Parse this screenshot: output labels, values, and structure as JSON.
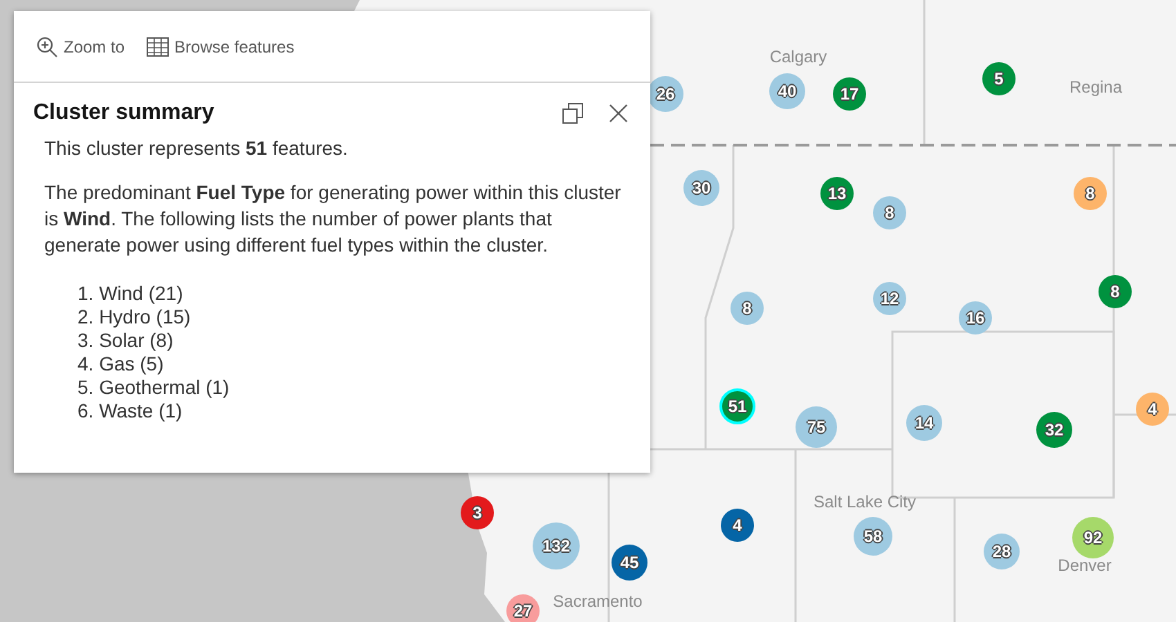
{
  "popup": {
    "actions": [
      {
        "kind": "zoom",
        "label": "Zoom to"
      },
      {
        "kind": "table",
        "label": "Browse features"
      }
    ],
    "title": "Cluster summary",
    "paragraphs": [
      "This cluster represents **51** features.",
      "The predominant **Fuel Type** for generating power within this cluster is **Wind**. The following lists the number of power plants that generate power using different fuel types within the cluster."
    ],
    "list": [
      "1. Wind (21)",
      "2. Hydro (15)",
      "3. Solar (8)",
      "4. Gas (5)",
      "5. Geothermal (1)",
      "6. Waste (1)"
    ]
  },
  "map": {
    "places": [
      "Calgary",
      "Regina",
      "Salt Lake City",
      "Denver",
      "Sacramento"
    ],
    "clusters": [
      {
        "label": "26",
        "color": "#9ecae1",
        "selected": false
      },
      {
        "label": "40",
        "color": "#9ecae1",
        "selected": false
      },
      {
        "label": "17",
        "color": "#00923f",
        "selected": false
      },
      {
        "label": "5",
        "color": "#00923f",
        "selected": false
      },
      {
        "label": "30",
        "color": "#9ecae1",
        "selected": false
      },
      {
        "label": "13",
        "color": "#00923f",
        "selected": false
      },
      {
        "label": "8",
        "color": "#9ecae1",
        "selected": false
      },
      {
        "label": "8",
        "color": "#fdb46a",
        "selected": false
      },
      {
        "label": "8",
        "color": "#9ecae1",
        "selected": false
      },
      {
        "label": "12",
        "color": "#9ecae1",
        "selected": false
      },
      {
        "label": "16",
        "color": "#9ecae1",
        "selected": false
      },
      {
        "label": "8",
        "color": "#00923f",
        "selected": false
      },
      {
        "label": "51",
        "color": "#00923f",
        "selected": true
      },
      {
        "label": "75",
        "color": "#9ecae1",
        "selected": false
      },
      {
        "label": "14",
        "color": "#9ecae1",
        "selected": false
      },
      {
        "label": "32",
        "color": "#00923f",
        "selected": false
      },
      {
        "label": "4",
        "color": "#fdb46a",
        "selected": false
      },
      {
        "label": "3",
        "color": "#e31a1c",
        "selected": false
      },
      {
        "label": "132",
        "color": "#9ecae1",
        "selected": false
      },
      {
        "label": "45",
        "color": "#0565a6",
        "selected": false
      },
      {
        "label": "4",
        "color": "#0565a6",
        "selected": false
      },
      {
        "label": "58",
        "color": "#9ecae1",
        "selected": false
      },
      {
        "label": "28",
        "color": "#9ecae1",
        "selected": false
      },
      {
        "label": "92",
        "color": "#a6d96a",
        "selected": false
      },
      {
        "label": "27",
        "color": "#f89c9c",
        "selected": false
      }
    ]
  }
}
